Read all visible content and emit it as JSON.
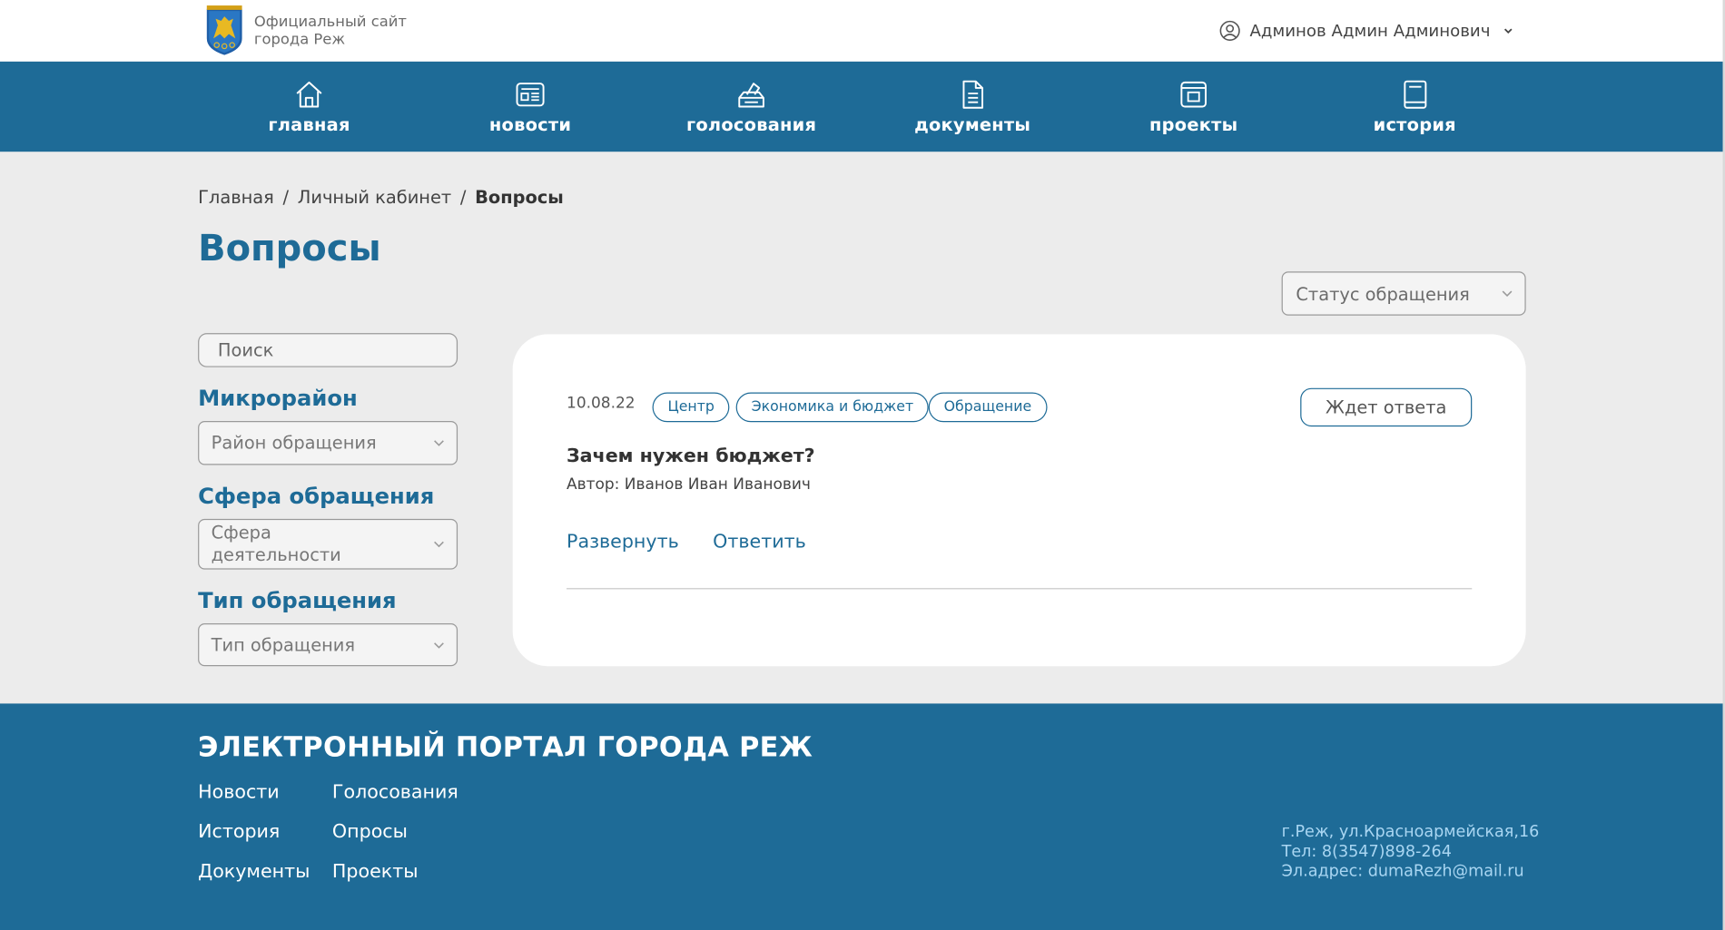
{
  "header": {
    "site_name_line1": "Официальный сайт",
    "site_name_line2": "города Реж",
    "user_name": "Админов Админ Админович"
  },
  "nav": {
    "items": [
      {
        "label": "главная",
        "icon": "home-icon"
      },
      {
        "label": "новости",
        "icon": "newspaper-icon"
      },
      {
        "label": "голосования",
        "icon": "ballot-box-icon"
      },
      {
        "label": "документы",
        "icon": "document-icon"
      },
      {
        "label": "проекты",
        "icon": "project-icon"
      },
      {
        "label": "история",
        "icon": "book-icon"
      }
    ]
  },
  "breadcrumb": {
    "items": [
      "Главная",
      "Личный кабинет",
      "Вопросы"
    ],
    "separator": "/"
  },
  "page": {
    "title": "Вопросы"
  },
  "status_filter": {
    "placeholder": "Статус обращения"
  },
  "sidebar": {
    "search_placeholder": "Поиск",
    "district": {
      "heading": "Микрорайон",
      "placeholder": "Район обращения"
    },
    "sphere": {
      "heading": "Сфера обращения",
      "placeholder": "Сфера деятельности"
    },
    "type": {
      "heading": "Тип обращения",
      "placeholder": "Тип обращения"
    }
  },
  "question": {
    "date": "10.08.22",
    "tags": [
      "Центр",
      "Экономика и бюджет",
      "Обращение"
    ],
    "status": "Ждет ответа",
    "title": "Зачем нужен бюджет?",
    "author": "Автор: Иванов Иван Иванович",
    "expand_label": "Развернуть",
    "reply_label": "Ответить"
  },
  "footer": {
    "title": "ЭЛЕКТРОННЫЙ ПОРТАЛ ГОРОДА РЕЖ",
    "links": {
      "news": "Новости",
      "votes": "Голосования",
      "history": "История",
      "polls": "Опросы",
      "documents": "Документы",
      "projects": "Проекты"
    },
    "address": "г.Реж, ул.Красноармейская,16",
    "phone": "Тел: 8(3547)898-264",
    "email": "Эл.адрес: dumaRezh@mail.ru"
  },
  "colors": {
    "brand": "#1e6b97",
    "page_bg": "#ececec",
    "footer_contacts": "#a9d6f2"
  }
}
